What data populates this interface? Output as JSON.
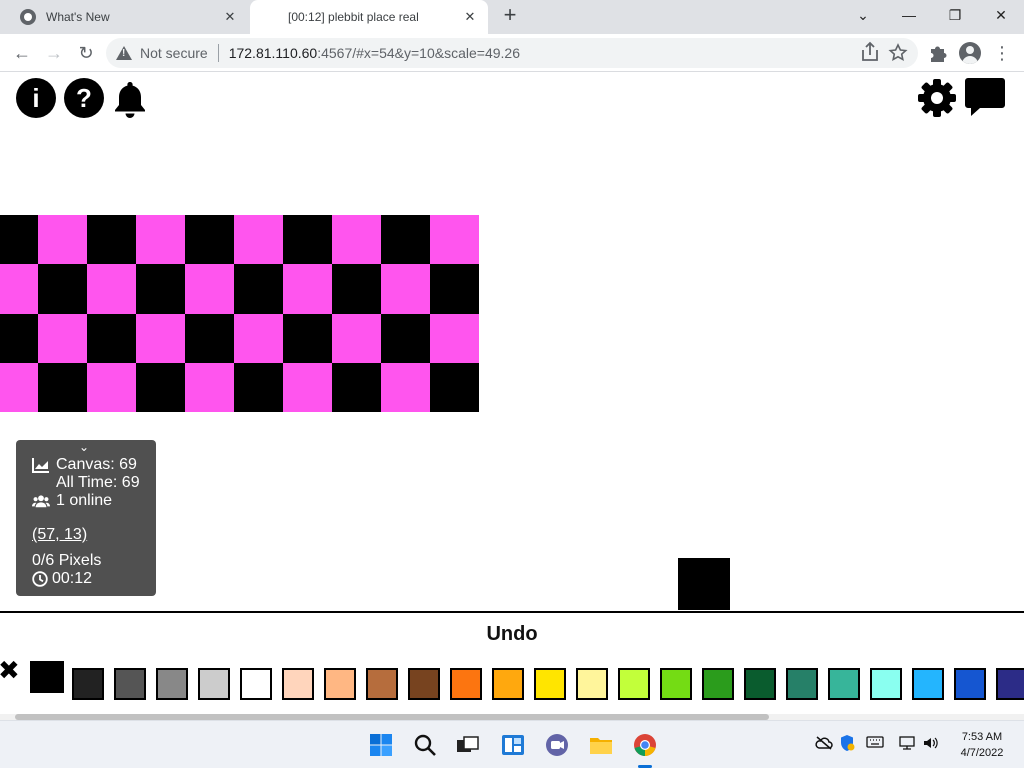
{
  "browser": {
    "tabs": [
      {
        "title": "What's New",
        "close": "✕"
      },
      {
        "title": "[00:12] plebbit place real",
        "close": "✕"
      }
    ],
    "new_tab": "+",
    "window_controls": {
      "minimize": "—",
      "restore": "❐",
      "close": "✕",
      "tabsearch": "⌄"
    },
    "nav": {
      "back": "←",
      "forward": "→",
      "reload": "↻"
    },
    "address": {
      "security_label": "Not secure",
      "host": "172.81.110.60",
      "path": ":4567/#x=54&y=10&scale=49.26"
    },
    "icons": [
      "share-icon",
      "bookmark-star-icon",
      "extensions-icon",
      "profile-icon",
      "menu-icon"
    ],
    "menu_glyph": "⋮"
  },
  "page": {
    "top_buttons": {
      "info": "i",
      "help": "?"
    },
    "pixel_colors": {
      "black": "#000000",
      "pink": "#ff55ee"
    },
    "stats": {
      "collapse": "⌄",
      "canvas": "Canvas: 69",
      "all_time": "All Time: 69",
      "online": "1 online",
      "coords": "(57, 13)",
      "pixels": "0/6 Pixels",
      "timer": "00:12"
    },
    "undo_label": "Undo",
    "close_palette": "✖",
    "selected_color": "#000000",
    "palette": [
      "#222222",
      "#555555",
      "#888888",
      "#cccccc",
      "#ffffff",
      "#ffd5bc",
      "#ffb783",
      "#b66d3d",
      "#77431f",
      "#fc7510",
      "#ffa80e",
      "#ffe500",
      "#fff59b",
      "#c2ff3a",
      "#74dc14",
      "#2b9c1c",
      "#0a5c2e",
      "#268068",
      "#37b59a",
      "#8afff0",
      "#24b5fe",
      "#1556d1",
      "#2c2c87"
    ]
  },
  "taskbar": {
    "time": "7:53 AM",
    "date": "4/7/2022"
  }
}
